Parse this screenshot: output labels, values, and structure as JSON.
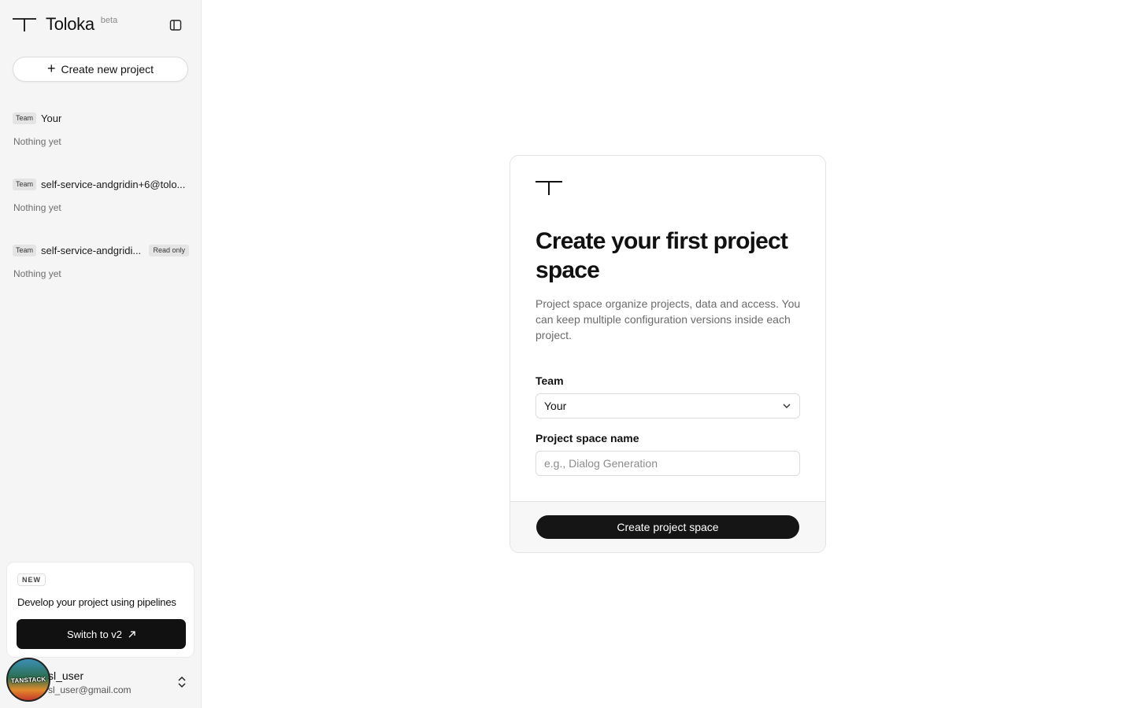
{
  "app": {
    "name": "Toloka",
    "badge": "beta"
  },
  "sidebar": {
    "new_project_label": "Create new project",
    "teams": [
      {
        "badge": "Team",
        "name": "Your",
        "status": "Nothing yet",
        "extra_badge": ""
      },
      {
        "badge": "Team",
        "name": "self-service-andgridin+6@tolo...",
        "status": "Nothing yet",
        "extra_badge": ""
      },
      {
        "badge": "Team",
        "name": "self-service-andgridi...",
        "status": "Nothing yet",
        "extra_badge": "Read only"
      }
    ],
    "promo": {
      "tag": "NEW",
      "title": "Develop your project using pipelines",
      "button_label": "Switch to v2",
      "button_icon": "arrow-up-right-icon"
    },
    "user": {
      "name": "sl_user",
      "email": "sl_user@gmail.com",
      "avatar_text": "TANSTACK"
    }
  },
  "card": {
    "title": "Create your first project space",
    "description": "Project space organize projects, data and access. You can keep multiple configuration versions inside each project.",
    "team_label": "Team",
    "team_value": "Your",
    "name_label": "Project space name",
    "name_placeholder": "e.g., Dialog Generation",
    "name_value": "",
    "submit_label": "Create project space"
  },
  "colors": {
    "sidebar_bg": "#f5f5f5",
    "primary": "#151515",
    "muted_text": "#6b6b6b"
  }
}
